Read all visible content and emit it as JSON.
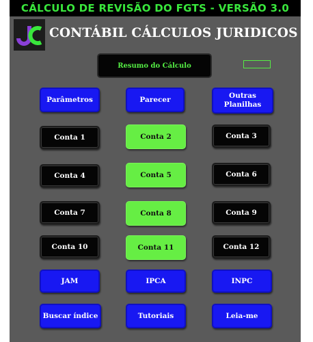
{
  "title": "CÁLCULO DE REVISÃO DO FGTS - VERSÃO 3.0",
  "company": "CONTÁBIL CÁLCULOS JURIDICOS",
  "logo_text": "JC",
  "colors": {
    "title_text": "#39e63c",
    "panel": "#5a5a5a",
    "blue_button": "#1818f2",
    "green_button": "#66ee44",
    "black_button": "#050505"
  },
  "buttons": {
    "resumo": "Resumo do Cálculo",
    "parametros": "Parâmetros",
    "parecer": "Parecer",
    "outras": "Outras Planilhas",
    "conta1": "Conta 1",
    "conta2": "Conta 2",
    "conta3": "Conta 3",
    "conta4": "Conta 4",
    "conta5": "Conta 5",
    "conta6": "Conta 6",
    "conta7": "Conta 7",
    "conta8": "Conta 8",
    "conta9": "Conta 9",
    "conta10": "Conta 10",
    "conta11": "Conta 11",
    "conta12": "Conta 12",
    "jam": "JAM",
    "ipca": "IPCA",
    "inpc": "INPC",
    "buscar": "Buscar índice",
    "tutoriais": "Tutoriais",
    "leiame": "Leia-me"
  }
}
